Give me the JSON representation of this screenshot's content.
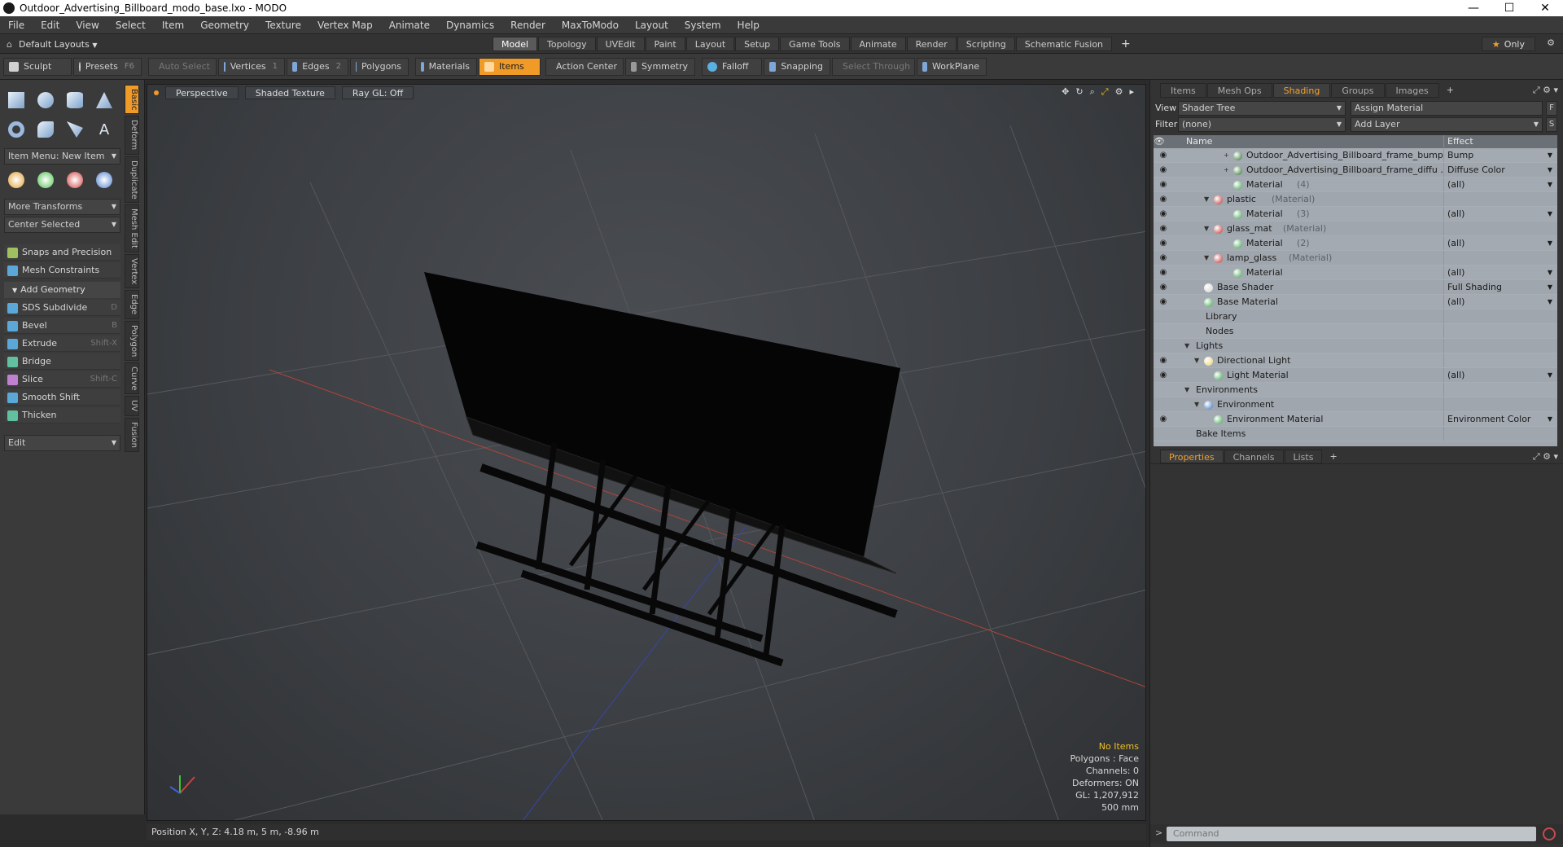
{
  "window": {
    "title": "Outdoor_Advertising_Billboard_modo_base.lxo - MODO",
    "controls": [
      "—",
      "☐",
      "✕"
    ]
  },
  "menu": [
    "File",
    "Edit",
    "View",
    "Select",
    "Item",
    "Geometry",
    "Texture",
    "Vertex Map",
    "Animate",
    "Dynamics",
    "Render",
    "MaxToModo",
    "Layout",
    "System",
    "Help"
  ],
  "layout_bar": {
    "layouts_label": "Default Layouts",
    "tabs": [
      "Model",
      "Topology",
      "UVEdit",
      "Paint",
      "Layout",
      "Setup",
      "Game Tools",
      "Animate",
      "Render",
      "Scripting",
      "Schematic Fusion"
    ],
    "active_tab": "Model",
    "only_label": "Only"
  },
  "toolbar": {
    "sculpt": "Sculpt",
    "presets": "Presets",
    "presets_hotkey": "F6",
    "auto_select": "Auto Select",
    "vertices": "Vertices",
    "vertices_hotkey": "1",
    "edges": "Edges",
    "edges_hotkey": "2",
    "polygons": "Polygons",
    "materials": "Materials",
    "items": "Items",
    "action_center": "Action Center",
    "symmetry": "Symmetry",
    "falloff": "Falloff",
    "snapping": "Snapping",
    "select_through": "Select Through",
    "workplane": "WorkPlane"
  },
  "left_panel": {
    "item_menu": "Item Menu: New Item",
    "more_transforms": "More Transforms",
    "center_selected": "Center Selected",
    "snaps": "Snaps and Precision",
    "mesh_constraints": "Mesh Constraints",
    "add_geometry": "Add Geometry",
    "tools": [
      {
        "label": "SDS Subdivide",
        "hotkey": "D"
      },
      {
        "label": "Bevel",
        "hotkey": "B"
      },
      {
        "label": "Extrude",
        "hotkey": "Shift-X"
      },
      {
        "label": "Bridge",
        "hotkey": ""
      },
      {
        "label": "Slice",
        "hotkey": "Shift-C"
      },
      {
        "label": "Smooth Shift",
        "hotkey": ""
      },
      {
        "label": "Thicken",
        "hotkey": ""
      }
    ],
    "edit_dd": "Edit",
    "vertical_tabs": [
      "Basic",
      "Deform",
      "Duplicate",
      "Mesh Edit",
      "Vertex",
      "Edge",
      "Polygon",
      "Curve",
      "UV",
      "Fusion"
    ]
  },
  "viewport": {
    "tabs": [
      "Perspective",
      "Shaded Texture",
      "Ray GL: Off"
    ],
    "info": {
      "no_items": "No Items",
      "polygons": "Polygons : Face",
      "channels": "Channels: 0",
      "deformers": "Deformers: ON",
      "gl": "GL: 1,207,912",
      "scale": "500 mm"
    },
    "axis_labels": {
      "x": "X",
      "y": "Y",
      "z": "Z"
    }
  },
  "status": {
    "position": "Position X, Y, Z:   4.18 m, 5 m, -8.96 m"
  },
  "right_panel": {
    "tabs": [
      "Items",
      "Mesh Ops",
      "Shading",
      "Groups",
      "Images"
    ],
    "active_tab": "Shading",
    "view_label": "View",
    "view_value": "Shader Tree",
    "assign_material": "Assign Material",
    "f_btn": "F",
    "filter_label": "Filter",
    "filter_value": "(none)",
    "add_layer": "Add Layer",
    "s_btn": "S",
    "tree": {
      "col_name": "Name",
      "col_effect": "Effect",
      "rows": [
        {
          "eye": true,
          "indent": 4,
          "exp": "+",
          "ball": "#2a6e2a",
          "label": "Outdoor_Advertising_Billboard_frame_bump...",
          "sub": "",
          "effect": "Bump",
          "dd": true
        },
        {
          "eye": true,
          "indent": 4,
          "exp": "+",
          "ball": "#2a6e2a",
          "label": "Outdoor_Advertising_Billboard_frame_diffu ...",
          "sub": "",
          "effect": "Diffuse Color",
          "dd": true
        },
        {
          "eye": true,
          "indent": 4,
          "exp": "",
          "ball": "#3aa04a",
          "label": "Material",
          "sub": "(4)",
          "effect": "(all)",
          "dd": true
        },
        {
          "eye": true,
          "indent": 2,
          "exp": "▼",
          "ball": "#c03030",
          "label": "plastic",
          "sub": "(Material)",
          "effect": "",
          "dd": false
        },
        {
          "eye": true,
          "indent": 4,
          "exp": "",
          "ball": "#3aa04a",
          "label": "Material",
          "sub": "(3)",
          "effect": "(all)",
          "dd": true
        },
        {
          "eye": true,
          "indent": 2,
          "exp": "▼",
          "ball": "#c03030",
          "label": "glass_mat",
          "sub": "(Material)",
          "effect": "",
          "dd": false
        },
        {
          "eye": true,
          "indent": 4,
          "exp": "",
          "ball": "#3aa04a",
          "label": "Material",
          "sub": "(2)",
          "effect": "(all)",
          "dd": true
        },
        {
          "eye": true,
          "indent": 2,
          "exp": "▼",
          "ball": "#c03030",
          "label": "lamp_glass",
          "sub": "(Material)",
          "effect": "",
          "dd": false
        },
        {
          "eye": true,
          "indent": 4,
          "exp": "",
          "ball": "#3aa04a",
          "label": "Material",
          "sub": "",
          "effect": "(all)",
          "dd": true
        },
        {
          "eye": true,
          "indent": 1,
          "exp": "",
          "ball": "#d0d0d0",
          "label": "Base Shader",
          "sub": "",
          "effect": "Full Shading",
          "dd": true
        },
        {
          "eye": true,
          "indent": 1,
          "exp": "",
          "ball": "#3aa04a",
          "label": "Base Material",
          "sub": "",
          "effect": "(all)",
          "dd": true
        },
        {
          "eye": false,
          "indent": 1,
          "exp": "",
          "ball": "",
          "label": "Library",
          "sub": "",
          "effect": "",
          "dd": false
        },
        {
          "eye": false,
          "indent": 1,
          "exp": "",
          "ball": "",
          "label": "Nodes",
          "sub": "",
          "effect": "",
          "dd": false
        },
        {
          "eye": false,
          "indent": 0,
          "exp": "▼",
          "ball": "",
          "label": "Lights",
          "sub": "",
          "effect": "",
          "dd": false
        },
        {
          "eye": true,
          "indent": 1,
          "exp": "▼",
          "ball": "#e8d070",
          "label": "Directional Light",
          "sub": "",
          "effect": "",
          "dd": false
        },
        {
          "eye": true,
          "indent": 2,
          "exp": "",
          "ball": "#3aa04a",
          "label": "Light Material",
          "sub": "",
          "effect": "(all)",
          "dd": true
        },
        {
          "eye": false,
          "indent": 0,
          "exp": "▼",
          "ball": "",
          "label": "Environments",
          "sub": "",
          "effect": "",
          "dd": false
        },
        {
          "eye": false,
          "indent": 1,
          "exp": "▼",
          "ball": "#3a6ac0",
          "label": "Environment",
          "sub": "",
          "effect": "",
          "dd": false
        },
        {
          "eye": true,
          "indent": 2,
          "exp": "",
          "ball": "#3aa04a",
          "label": "Environment Material",
          "sub": "",
          "effect": "Environment Color",
          "dd": true
        },
        {
          "eye": false,
          "indent": 0,
          "exp": "",
          "ball": "",
          "label": "Bake Items",
          "sub": "",
          "effect": "",
          "dd": false
        }
      ]
    },
    "props_tabs": [
      "Properties",
      "Channels",
      "Lists"
    ],
    "props_active": "Properties",
    "command_placeholder": "Command"
  }
}
